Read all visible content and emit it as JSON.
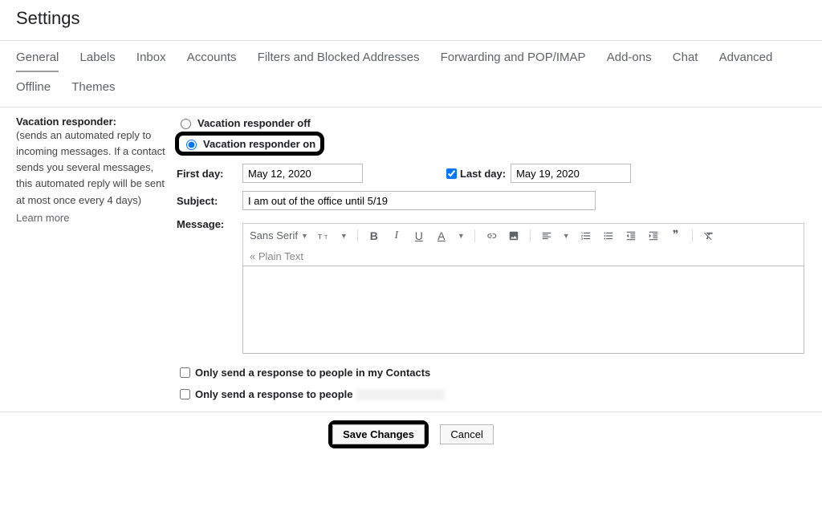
{
  "header": {
    "title": "Settings"
  },
  "tabs_row1": [
    {
      "label": "General",
      "active": true
    },
    {
      "label": "Labels"
    },
    {
      "label": "Inbox"
    },
    {
      "label": "Accounts"
    },
    {
      "label": "Filters and Blocked Addresses"
    },
    {
      "label": "Forwarding and POP/IMAP"
    },
    {
      "label": "Add-ons"
    },
    {
      "label": "Chat"
    },
    {
      "label": "Advanced"
    }
  ],
  "tabs_row2": [
    {
      "label": "Offline"
    },
    {
      "label": "Themes"
    }
  ],
  "section": {
    "title": "Vacation responder:",
    "desc": "(sends an automated reply to incoming messages. If a contact sends you several messages, this automated reply will be sent at most once every 4 days)",
    "learn": "Learn more"
  },
  "radios": {
    "off": "Vacation responder off",
    "on": "Vacation responder on"
  },
  "fields": {
    "first_day_label": "First day:",
    "first_day_value": "May 12, 2020",
    "last_day_label": "Last day:",
    "last_day_value": "May 19, 2020",
    "last_day_checked": true,
    "subject_label": "Subject:",
    "subject_value": "I am out of the office until 5/19",
    "message_label": "Message:"
  },
  "toolbar": {
    "font": "Sans Serif",
    "plain": "« Plain Text"
  },
  "checks": {
    "contacts": "Only send a response to people in my Contacts",
    "domain": "Only send a response to people"
  },
  "buttons": {
    "save": "Save Changes",
    "cancel": "Cancel"
  }
}
